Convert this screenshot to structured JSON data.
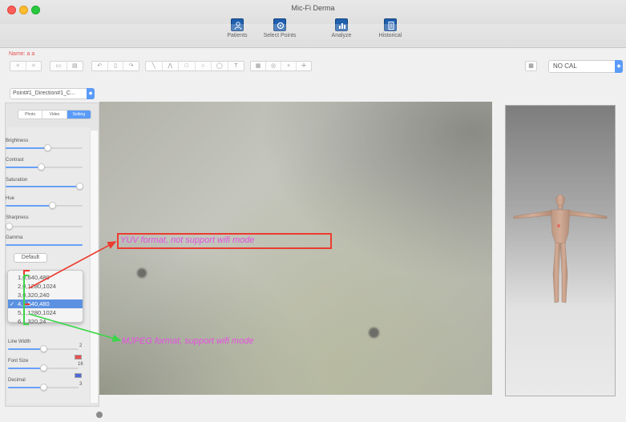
{
  "window": {
    "title": "Mic-Fi Derma"
  },
  "toolbar": {
    "items": [
      {
        "label": "Patients",
        "icon": "person-icon"
      },
      {
        "label": "Select Points",
        "icon": "select-points-icon"
      },
      {
        "label": "Analyze",
        "icon": "chart-icon"
      },
      {
        "label": "Historical",
        "icon": "document-icon"
      }
    ]
  },
  "patient": {
    "name_label": "Name: a a"
  },
  "calibration": {
    "selected": "NO CAL"
  },
  "point_selector": {
    "selected": "Point#1_Direction#1_C..."
  },
  "mode_tabs": {
    "items": [
      "Photo",
      "Video",
      "Setting"
    ],
    "active": "Setting"
  },
  "settings": {
    "sliders": [
      {
        "label": "Brightness",
        "value": 0.55
      },
      {
        "label": "Contrast",
        "value": 0.45
      },
      {
        "label": "Saturation",
        "value": 1.0
      },
      {
        "label": "Hue",
        "value": 0.6
      },
      {
        "label": "Sharpness",
        "value": 0.0
      },
      {
        "label": "Gamma",
        "value": 1.0
      }
    ],
    "default_label": "Default",
    "line_width": {
      "label": "Line Width",
      "value": "2"
    },
    "font_size": {
      "label": "Font Size",
      "value": "16",
      "color": "#e02020"
    },
    "decimal": {
      "label": "Decimal",
      "value": "3",
      "color": "#1f3fd0"
    }
  },
  "resolution_dropdown": {
    "options": [
      "1,0,640,480",
      "2,0,1280,1024",
      "3,0,320,240",
      "4,1,640,480",
      "5,1,1280,1024",
      "6,1,320,24"
    ],
    "selected_index": 3
  },
  "annotations": {
    "yuv": "YUV format, not support wifi mode",
    "mjpeg": "MJPEG format, support wifi mode"
  },
  "colors": {
    "accent": "#2d7ff7",
    "annotation": "#e54fe0",
    "red": "#ec3b30",
    "green": "#3bd64a"
  }
}
